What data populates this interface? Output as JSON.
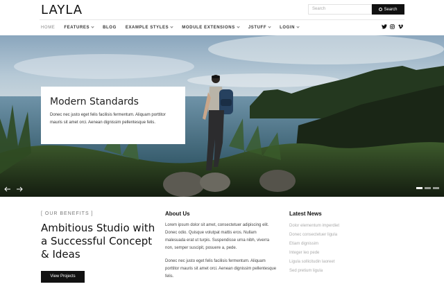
{
  "header": {
    "logo": "LAYLA",
    "search_placeholder": "Search",
    "search_button": "Search"
  },
  "nav": {
    "items": [
      {
        "label": "HOME",
        "dropdown": false
      },
      {
        "label": "FEATURES",
        "dropdown": true
      },
      {
        "label": "BLOG",
        "dropdown": false
      },
      {
        "label": "EXAMPLE STYLES",
        "dropdown": true
      },
      {
        "label": "MODULE EXTENSIONS",
        "dropdown": true
      },
      {
        "label": "JSTUFF",
        "dropdown": true
      },
      {
        "label": "LOGIN",
        "dropdown": true
      }
    ],
    "social": [
      "twitter-icon",
      "instagram-icon",
      "vimeo-icon"
    ]
  },
  "hero": {
    "title": "Modern Standards",
    "text": "Donec nec justo eget felis facilisis fermentum. Aliquam porttitor mauris sit amet orci. Aenean dignissim pellentesque felis.",
    "slides_total": 3,
    "active_slide": 1
  },
  "benefits": {
    "kicker": "[ OUR BENEFITS ]",
    "title": "Ambitious Studio with a Successful Concept & Ideas",
    "button": "View Projects"
  },
  "about": {
    "heading": "About Us",
    "para1": "Lorem ipsum dolor sit amet, consectetuer adipiscing elit. Donec odio. Quisque volutpat mattis eros. Nullam malesuada erat ut turpis. Suspendisse urna nibh, viverra non, semper suscipit, posuere a, pede.",
    "para2": "Donec nec justo eget felis facilisis fermentum. Aliquam porttitor mauris sit amet orci. Aenean dignissim pellentesque felis."
  },
  "news": {
    "heading": "Latest News",
    "items": [
      "Dolor elementum imperdiet",
      "Donec consectetuer ligula",
      "Etiam dignissim",
      "Integer leo pede",
      "Ligula sollicitudin laoreet",
      "Sed pretium ligula"
    ]
  },
  "colors": {
    "accent": "#111111",
    "muted": "#aaaaaa"
  }
}
